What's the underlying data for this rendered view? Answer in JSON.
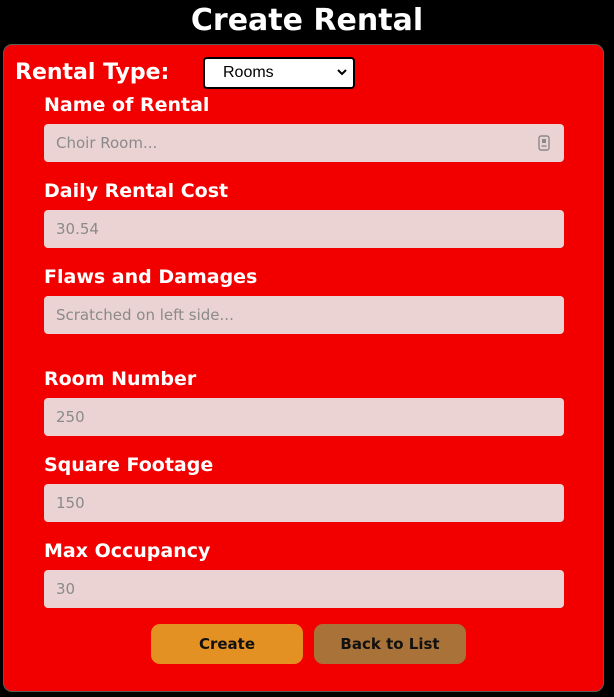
{
  "page": {
    "title": "Create Rental"
  },
  "rental_type": {
    "label": "Rental Type:",
    "selected": "Rooms",
    "icon": "chevron-down-icon"
  },
  "fields": {
    "name_of_rental": {
      "label": "Name of Rental",
      "placeholder": "Choir Room...",
      "icon": "autofill-icon"
    },
    "daily_rental_cost": {
      "label": "Daily Rental Cost",
      "placeholder": "30.54"
    },
    "flaws_and_damages": {
      "label": "Flaws and Damages",
      "placeholder": "Scratched on left side..."
    },
    "room_number": {
      "label": "Room Number",
      "placeholder": "250"
    },
    "square_footage": {
      "label": "Square Footage",
      "placeholder": "150"
    },
    "max_occupancy": {
      "label": "Max Occupancy",
      "placeholder": "30"
    }
  },
  "buttons": {
    "create": "Create",
    "back_to_list": "Back to List"
  },
  "colors": {
    "panel": "#f20000",
    "input_bg": "#ecd3d3",
    "create_button": "#e39122",
    "back_button": "#a87238"
  }
}
